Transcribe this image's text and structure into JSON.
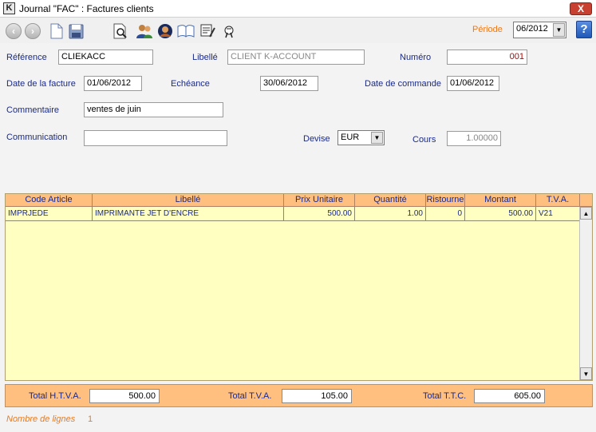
{
  "window": {
    "title": "Journal \"FAC\" : Factures clients",
    "app_letter": "K",
    "close_glyph": "X"
  },
  "toolbar": {
    "periode_label": "Période",
    "periode_value": "06/2012",
    "help_glyph": "?"
  },
  "form": {
    "reference_label": "Référence",
    "reference_value": "CLIEKACC",
    "libelle_label": "Libellé",
    "libelle_value": "CLIENT K-ACCOUNT",
    "numero_label": "Numéro",
    "numero_value": "001",
    "date_facture_label": "Date de la facture",
    "date_facture_value": "01/06/2012",
    "echeance_label": "Echéance",
    "echeance_value": "30/06/2012",
    "date_commande_label": "Date de commande",
    "date_commande_value": "01/06/2012",
    "commentaire_label": "Commentaire",
    "commentaire_value": "ventes de juin",
    "communication_label": "Communication",
    "communication_value": "",
    "devise_label": "Devise",
    "devise_value": "EUR",
    "cours_label": "Cours",
    "cours_value": "1.00000"
  },
  "grid": {
    "headers": [
      "Code Article",
      "Libellé",
      "Prix Unitaire",
      "Quantité",
      "Ristourne",
      "Montant",
      "T.V.A."
    ],
    "rows": [
      {
        "code": "IMPRJEDE",
        "libelle": "IMPRIMANTE JET D'ENCRE",
        "prix": "500.00",
        "quantite": "1.00",
        "ristourne": "0",
        "montant": "500.00",
        "tva": "V21"
      }
    ]
  },
  "totals": {
    "htva_label": "Total H.T.V.A.",
    "htva_value": "500.00",
    "tva_label": "Total T.V.A.",
    "tva_value": "105.00",
    "ttc_label": "Total T.T.C.",
    "ttc_value": "605.00"
  },
  "footer": {
    "nb_lignes_label": "Nombre de lignes",
    "nb_lignes_value": "1"
  },
  "colors": {
    "accent_orange": "#e87a20",
    "header_orange": "#ffbf7f",
    "grid_yellow": "#ffffc2",
    "label_blue": "#1a2a8a"
  }
}
